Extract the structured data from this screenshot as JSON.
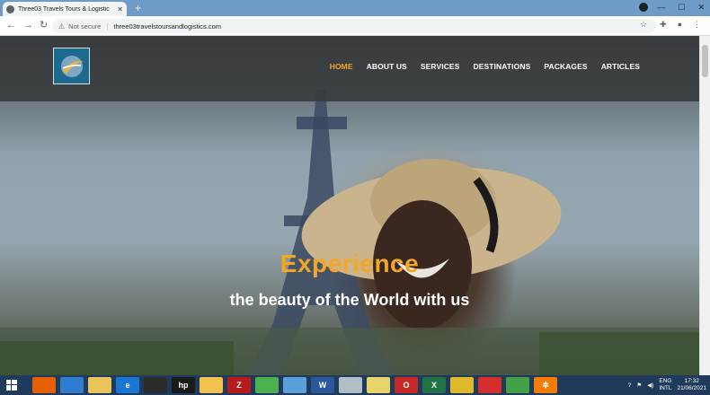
{
  "browser": {
    "tab_title": "Three03 Travels Tours & Logistic",
    "security_label": "Not secure",
    "url": "three03travelstoursandlogistics.com"
  },
  "site": {
    "nav": [
      "HOME",
      "ABOUT US",
      "SERVICES",
      "DESTINATIONS",
      "PACKAGES",
      "ARTICLES"
    ],
    "active_nav_color": "#f5a623",
    "hero_title": "Experience",
    "hero_tagline": "the beauty of the World with us"
  },
  "taskbar": {
    "apps": [
      "start-icon",
      "firefox-icon",
      "chrome-icon",
      "file-explorer-icon",
      "internet-explorer-icon",
      "media-player-icon",
      "hp-icon",
      "folder-icon",
      "filezilla-icon",
      "app-green-icon",
      "app-blue-icon",
      "word-icon",
      "notes-icon",
      "opera-icon",
      "excel-icon",
      "app-yellow-icon",
      "app-red-icon",
      "app-green2-icon",
      "settings-icon"
    ],
    "hp_label": "hp",
    "lang_top": "ENG",
    "lang_bottom": "INTL",
    "time": "17:32",
    "date": "21/06/2021"
  }
}
